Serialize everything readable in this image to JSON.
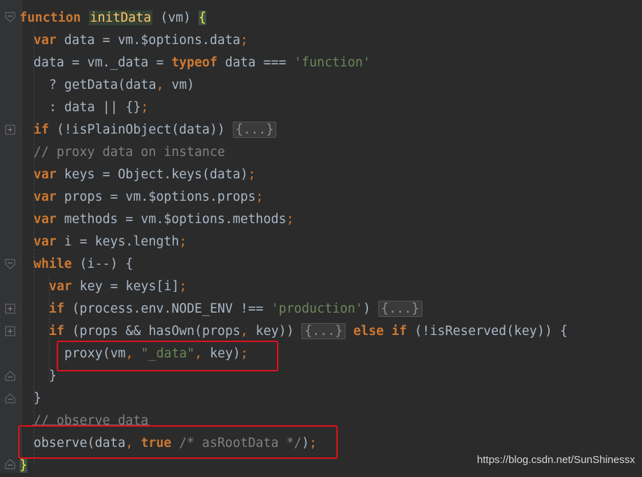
{
  "editor": {
    "lines": [
      {
        "t": "function initData (vm) {"
      },
      {
        "t": "var data = vm.$options.data;"
      },
      {
        "t": "data = vm._data = typeof data === 'function'"
      },
      {
        "t": "? getData(data, vm)"
      },
      {
        "t": ": data || {};"
      },
      {
        "t": "if (!isPlainObject(data)) {...}"
      },
      {
        "t": "// proxy data on instance"
      },
      {
        "t": "var keys = Object.keys(data);"
      },
      {
        "t": "var props = vm.$options.props;"
      },
      {
        "t": "var methods = vm.$options.methods;"
      },
      {
        "t": "var i = keys.length;"
      },
      {
        "t": "while (i--) {"
      },
      {
        "t": "var key = keys[i];"
      },
      {
        "t": "if (process.env.NODE_ENV !== 'production') {...}"
      },
      {
        "t": "if (props && hasOwn(props, key)) {...} else if (!isReserved(key)) {"
      },
      {
        "t": "proxy(vm, \"_data\", key);"
      },
      {
        "t": "}"
      },
      {
        "t": "}"
      },
      {
        "t": "// observe data"
      },
      {
        "t": "observe(data, true /* asRootData */);"
      },
      {
        "t": "}"
      }
    ],
    "fold_icons": [
      "fold-open",
      "fold-closed",
      "fold-open",
      "fold-closed",
      "fold-closed",
      "fold-end",
      "fold-end",
      "fold-end"
    ]
  },
  "tokens": {
    "l0": [
      "function",
      " ",
      "initData",
      " (vm) ",
      "{"
    ],
    "l1": [
      "var",
      " data = vm.$options.data",
      ";"
    ],
    "l2": [
      "data = vm._data = ",
      "typeof",
      " data === ",
      "'function'"
    ],
    "l3": [
      "? getData(data",
      ",",
      " vm)"
    ],
    "l4": [
      ": data || {}",
      ";"
    ],
    "l5": [
      "if",
      " (!isPlainObject(data)) ",
      "{...}"
    ],
    "l6": [
      "// proxy data on instance"
    ],
    "l7": [
      "var",
      " keys = Object.keys(data)",
      ";"
    ],
    "l8": [
      "var",
      " props = vm.$options.props",
      ";"
    ],
    "l9": [
      "var",
      " methods = vm.$options.methods",
      ";"
    ],
    "l10": [
      "var",
      " i = keys.length",
      ";"
    ],
    "l11": [
      "while",
      " (i--) {"
    ],
    "l12": [
      "var",
      " key = keys[i]",
      ";"
    ],
    "l13": [
      "if",
      " (process.env.NODE_ENV !== ",
      "'production'",
      ") ",
      "{...}"
    ],
    "l14": [
      "if",
      " (props && hasOwn(props",
      ",",
      " key)) ",
      "{...}",
      " ",
      "else if",
      " (!isReserved(key)) {"
    ],
    "l15": [
      "proxy(vm",
      ", ",
      "\"_data\"",
      ",",
      " key)",
      ";"
    ],
    "l16": [
      "}"
    ],
    "l17": [
      "}"
    ],
    "l18": [
      "// observe data"
    ],
    "l19": [
      "observe(data",
      ", ",
      "true",
      " ",
      "/* asRootData */",
      ")",
      ";"
    ],
    "l20": [
      "}"
    ]
  },
  "watermark": "https://blog.csdn.net/SunShinessx"
}
